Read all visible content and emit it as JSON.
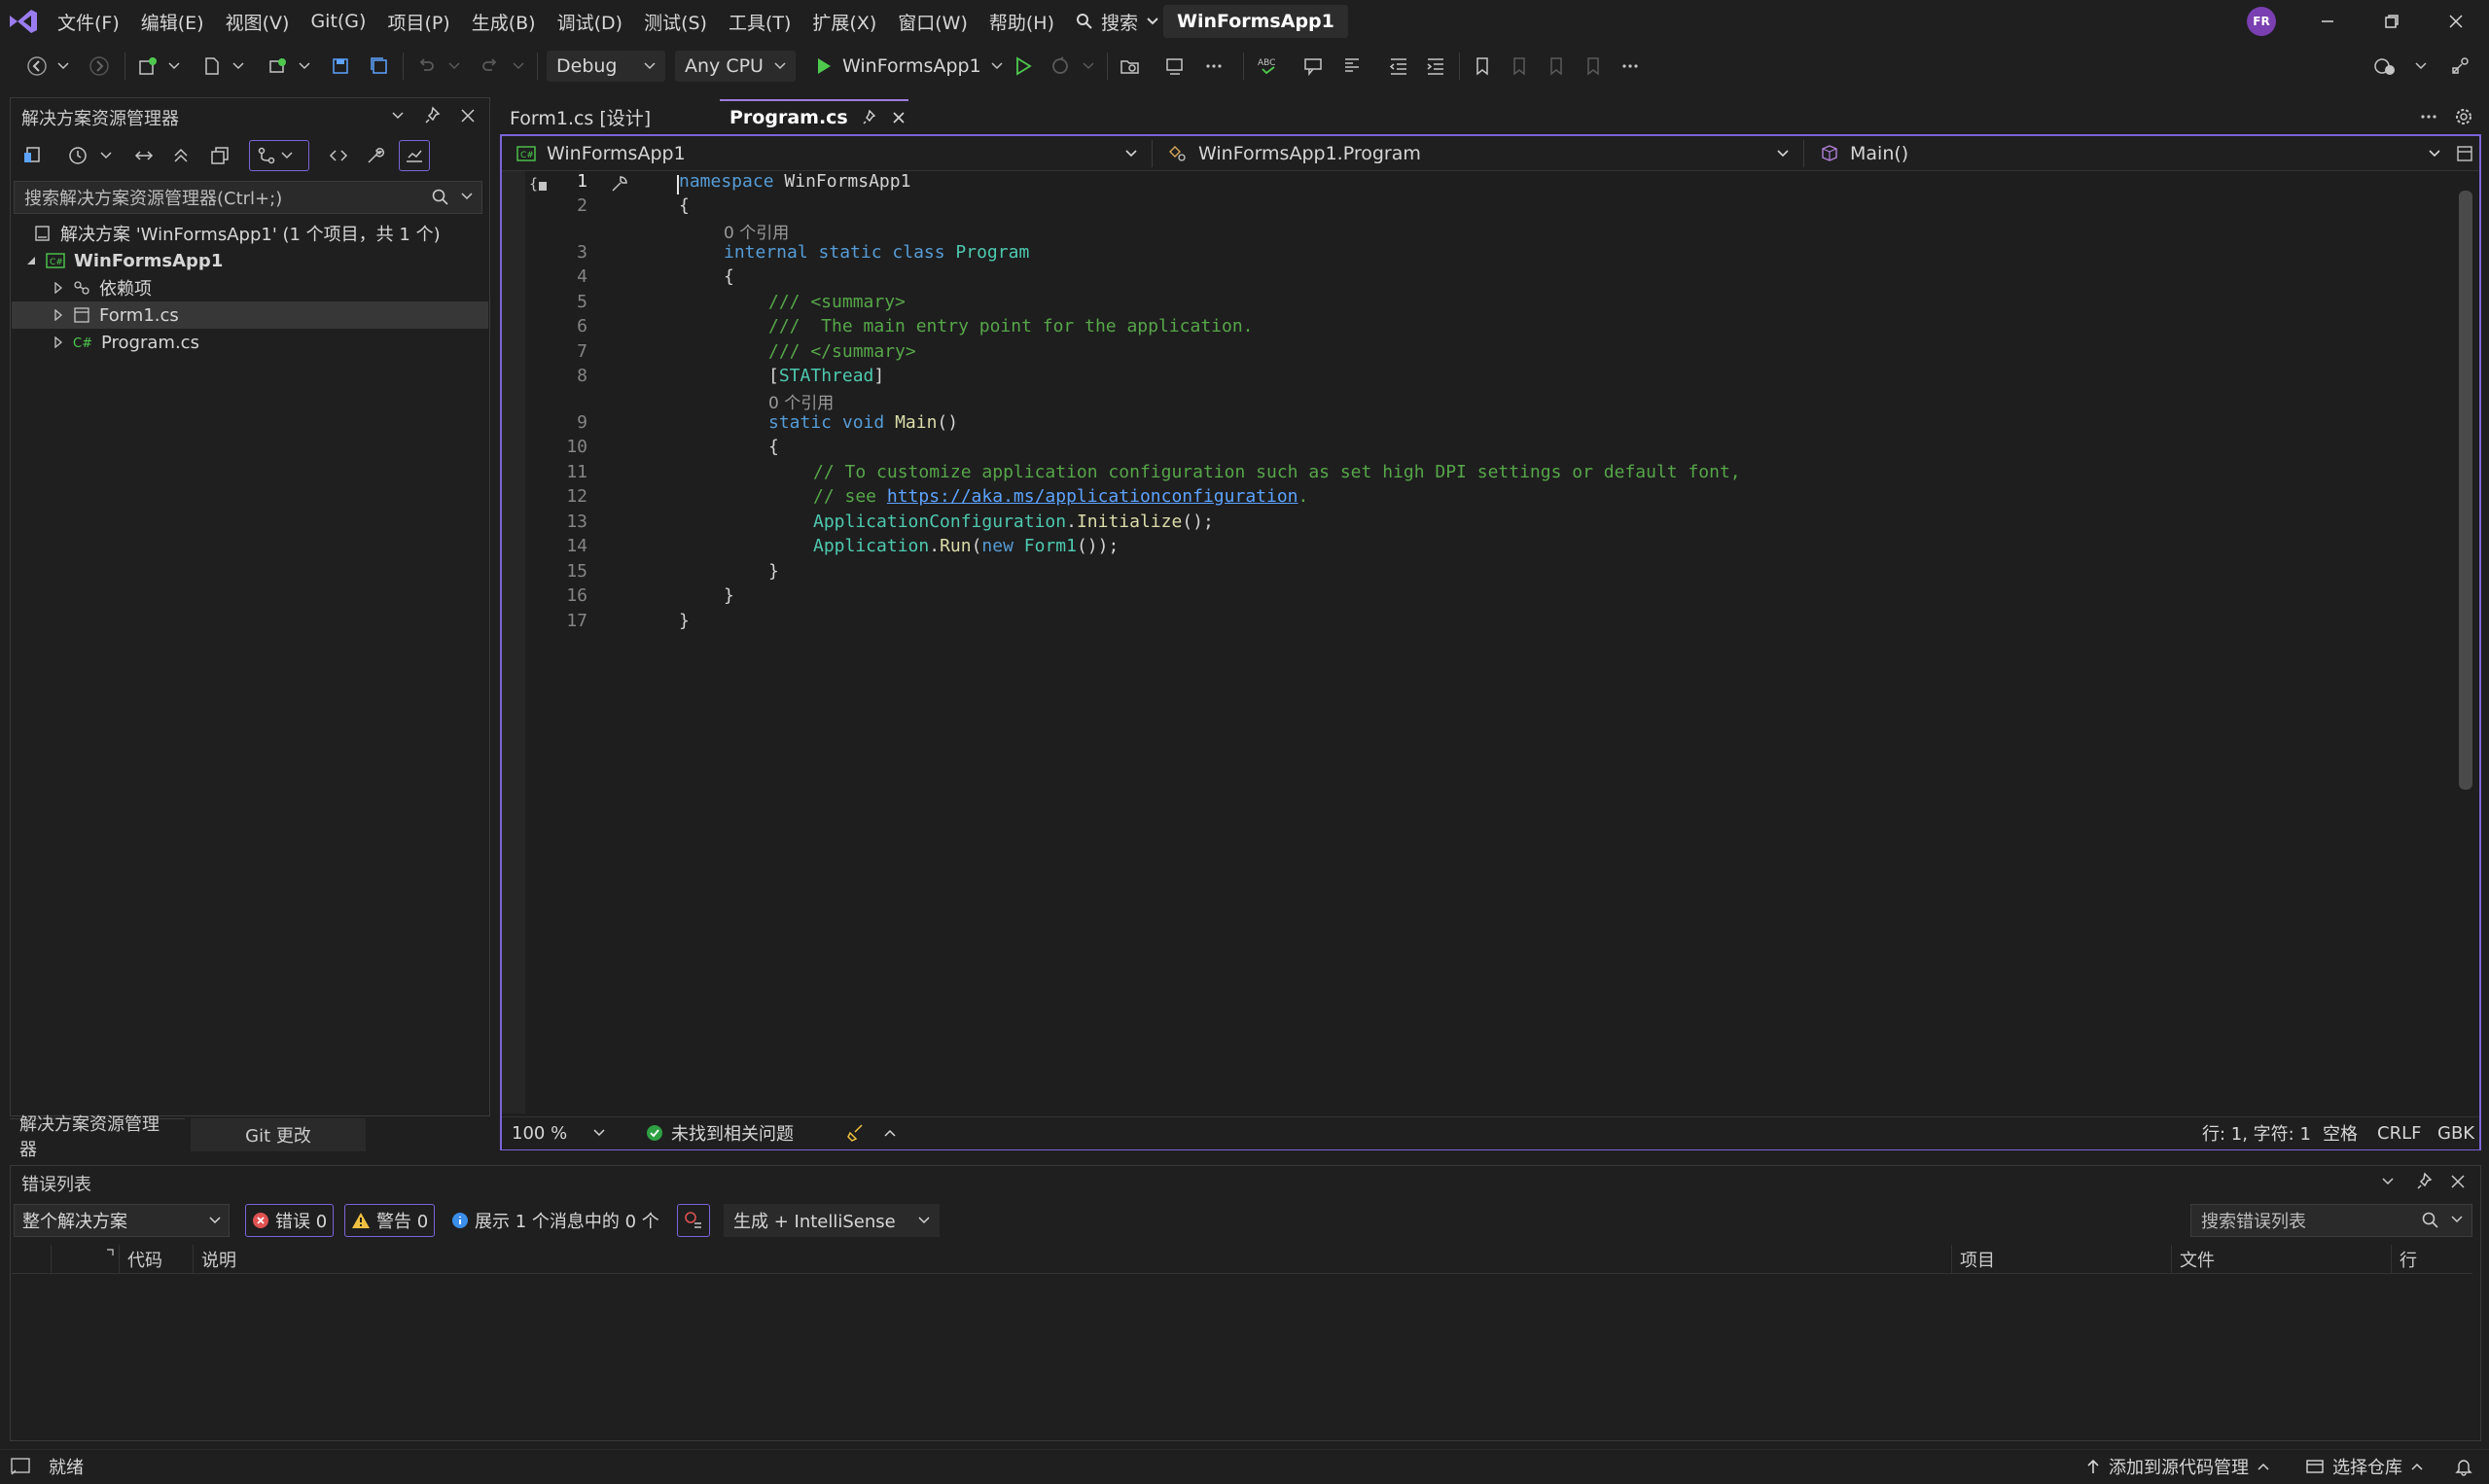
{
  "menu": {
    "items": [
      "文件(F)",
      "编辑(E)",
      "视图(V)",
      "Git(G)",
      "项目(P)",
      "生成(B)",
      "调试(D)",
      "测试(S)",
      "工具(T)",
      "扩展(X)",
      "窗口(W)",
      "帮助(H)"
    ],
    "search_label": "搜索",
    "solution_name": "WinFormsApp1",
    "avatar_initials": "FR"
  },
  "toolbar": {
    "config": "Debug",
    "platform": "Any CPU",
    "start_target": "WinFormsApp1"
  },
  "solution_explorer": {
    "title": "解决方案资源管理器",
    "search_placeholder": "搜索解决方案资源管理器(Ctrl+;)",
    "solution_label": "解决方案 'WinFormsApp1' (1 个项目，共 1 个)",
    "project": "WinFormsApp1",
    "items": [
      "依赖项",
      "Form1.cs",
      "Program.cs"
    ],
    "bottom_tabs": [
      "解决方案资源管理器",
      "Git 更改"
    ]
  },
  "editor": {
    "tabs": [
      {
        "label": "Form1.cs [设计]"
      },
      {
        "label": "Program.cs"
      }
    ],
    "nav": {
      "project": "WinFormsApp1",
      "type": "WinFormsApp1.Program",
      "member": "Main()"
    },
    "code_lens": "0 个引用",
    "line_numbers": [
      "1",
      "2",
      "3",
      "4",
      "5",
      "6",
      "7",
      "8",
      "9",
      "10",
      "11",
      "12",
      "13",
      "14",
      "15",
      "16",
      "17"
    ],
    "code": {
      "l1_kw": "namespace",
      "l1_name": "WinFormsApp1",
      "l3_kw": "internal static class",
      "l3_type": "Program",
      "l5": "/// <summary>",
      "l6": "///  The main entry point for the application.",
      "l7": "/// </summary>",
      "l8_attr": "STAThread",
      "l9_kw": "static void",
      "l9_fn": "Main",
      "l11": "// To customize application configuration such as set high DPI settings or default font,",
      "l12_pre": "// see ",
      "l12_link": "https://aka.ms/applicationconfiguration",
      "l13_type": "ApplicationConfiguration",
      "l13_fn": "Initialize",
      "l14_type": "Application",
      "l14_fn": "Run",
      "l14_kw": "new",
      "l14_type2": "Form1"
    },
    "status": {
      "zoom": "100 %",
      "issues": "未找到相关问题",
      "position": "行: 1, 字符: 1",
      "whitespace": "空格",
      "line_ending": "CRLF",
      "encoding": "GBK"
    }
  },
  "error_list": {
    "title": "错误列表",
    "scope": "整个解决方案",
    "errors": "错误 0",
    "warnings": "警告 0",
    "messages": "展示 1 个消息中的 0 个",
    "build_filter": "生成 + IntelliSense",
    "search_placeholder": "搜索错误列表",
    "columns": [
      "代码",
      "说明",
      "项目",
      "文件",
      "行"
    ]
  },
  "statusbar": {
    "ready": "就绪",
    "add_source_control": "添加到源代码管理",
    "select_repo": "选择仓库"
  },
  "colors": {
    "accent": "#7c64d8",
    "error": "#e05252",
    "warning": "#f0c040",
    "run": "#4ec94e"
  }
}
